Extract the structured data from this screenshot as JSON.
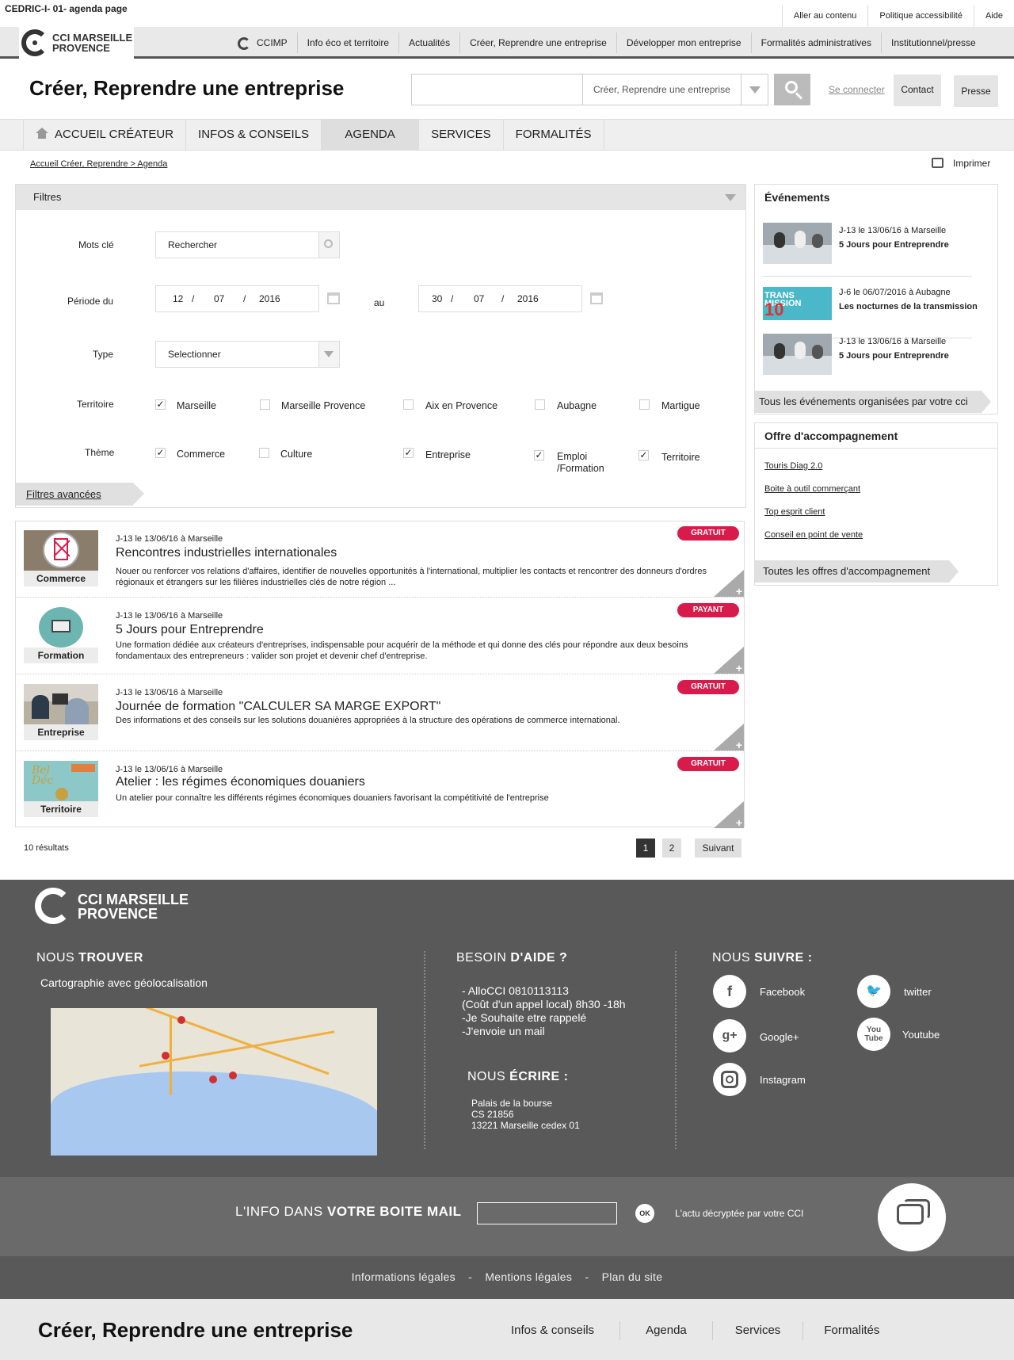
{
  "doc_title": "CEDRIC-I- 01- agenda page",
  "top_links": [
    "Aller au contenu",
    "Politique accessibilité",
    "Aide"
  ],
  "logo": {
    "line1": "CCI MARSEILLE",
    "line2": "PROVENCE"
  },
  "main_nav": [
    "CCIMP",
    "Info éco et territoire",
    "Actualités",
    "Créer, Reprendre une entreprise",
    "Développer mon entreprise",
    "Formalités administratives",
    "Institutionnel/presse"
  ],
  "section_title": "Créer, Reprendre une entreprise",
  "search": {
    "scope": "Créer, Reprendre une entreprise",
    "login": "Se connecter",
    "contact": "Contact",
    "presse": "Presse"
  },
  "sub_nav": [
    "ACCUEIL CRÉATEUR",
    "INFOS & CONSEILS",
    "AGENDA",
    "SERVICES",
    "FORMALITÉS"
  ],
  "breadcrumb": "Accueil Créer, Reprendre > Agenda",
  "print": "Imprimer",
  "filters": {
    "title": "Filtres",
    "keywords_label": "Mots clé",
    "keywords_placeholder": "Rechercher",
    "period_label": "Période du",
    "to_label": "au",
    "from_date": {
      "d": "12",
      "m": "07",
      "y": "2016"
    },
    "to_date": {
      "d": "30",
      "m": "07",
      "y": "2016"
    },
    "sep": "/",
    "type_label": "Type",
    "type_value": "Selectionner",
    "territory_label": "Territoire",
    "territories": [
      {
        "label": "Marseille",
        "checked": true
      },
      {
        "label": "Marseille Provence",
        "checked": false
      },
      {
        "label": "Aix en Provence",
        "checked": false
      },
      {
        "label": "Aubagne",
        "checked": false
      },
      {
        "label": "Martigue",
        "checked": false
      }
    ],
    "theme_label": "Thème",
    "themes": [
      {
        "label": "Commerce",
        "checked": true
      },
      {
        "label": "Culture",
        "checked": false
      },
      {
        "label": "Entreprise",
        "checked": true
      },
      {
        "label": "Emploi /Formation",
        "checked": true
      },
      {
        "label": "Territoire",
        "checked": true
      }
    ],
    "advanced": "Filtres avancées"
  },
  "events": [
    {
      "category": "Commerce",
      "date": "J-13  le 13/06/16  à Marseille",
      "title": "Rencontres industrielles internationales",
      "desc": "Nouer ou renforcer vos relations d'affaires, identifier de nouvelles opportunités à l'international, multiplier les contacts et rencontrer des donneurs d'ordres régionaux et étrangers sur les filières industrielles clés de notre région ...",
      "badge": "GRATUIT"
    },
    {
      "category": "Formation",
      "date": "J-13  le 13/06/16  à Marseille",
      "title": "5 Jours pour Entreprendre",
      "desc": "Une formation dédiée aux créateurs d'entreprises, indispensable pour acquérir de la méthode et qui donne des clés pour répondre aux deux besoins fondamentaux des entrepreneurs : valider son projet et devenir chef d'entreprise.",
      "badge": "PAYANT"
    },
    {
      "category": "Entreprise",
      "date": "J-13  le 13/06/16  à Marseille",
      "title": "Journée de formation \"CALCULER SA MARGE EXPORT\"",
      "desc": " Des informations et des conseils sur les solutions douanières appropriées à la structure des opérations de commerce international.",
      "badge": "GRATUIT"
    },
    {
      "category": "Territoire",
      "date": "J-13  le 13/06/16  à Marseille",
      "title": "Atelier : les régimes économiques douaniers",
      "desc": "Un atelier pour connaître les différents régimes économiques douaniers favorisant la compétitivité de l'entreprise",
      "badge": "GRATUIT"
    }
  ],
  "results": "10 résultats",
  "pagination": {
    "pages": [
      "1",
      "2"
    ],
    "next": "Suivant"
  },
  "sidebar": {
    "events_title": "Événements",
    "events": [
      {
        "meta": "J-13  le 13/06/16  à Marseille",
        "title": "5 Jours pour Entreprendre"
      },
      {
        "meta": "J-6  le 06/07/2016 à  Aubagne",
        "title": "Les nocturnes de la transmission"
      },
      {
        "meta": "J-13  le 13/06/16  à Marseille",
        "title": "5 Jours pour Entreprendre"
      }
    ],
    "events_cta": "Tous les événements organisées par votre cci",
    "offer_title": "Offre d'accompagnement",
    "offer_links": [
      "Touris Diag 2.0",
      "Boite à outil commerçant",
      "Top esprit client",
      "Conseil en point de vente"
    ],
    "offer_cta": "Toutes les offres d'accompagnement"
  },
  "footer": {
    "logo": {
      "line1": "CCI MARSEILLE",
      "line2": "PROVENCE"
    },
    "find": {
      "h1": "NOUS ",
      "h2": "TROUVER",
      "text": "Cartographie avec géolocalisation"
    },
    "help": {
      "h1": "BESOIN ",
      "h2": "D'AIDE ?",
      "lines": [
        "- AlloCCI 0810113113",
        "(Coût d'un appel local) 8h30 -18h",
        "-Je Souhaite etre rappelé",
        "-J'envoie un mail"
      ]
    },
    "write": {
      "h1": "NOUS ",
      "h2": "ÉCRIRE :",
      "lines": [
        "Palais de la bourse",
        "CS 21856",
        "13221 Marseille cedex 01"
      ]
    },
    "follow": {
      "h1": "NOUS ",
      "h2": "SUIVRE :"
    },
    "social": [
      "Facebook",
      "twitter",
      "Google+",
      "Youtube",
      "Instagram"
    ],
    "newsletter": {
      "h1": "L'INFO DANS ",
      "h2": "VOTRE BOITE MAIL",
      "ok": "OK",
      "tagline": "L'actu décryptée par votre CCI"
    },
    "legal": [
      "Informations légales",
      "-",
      "Mentions légales",
      "-",
      "Plan du site"
    ],
    "bottom_title": "Créer, Reprendre une entreprise",
    "bottom_links": [
      "Infos & conseils",
      "Agenda",
      "Services",
      "Formalités"
    ]
  },
  "colors": {
    "badge": "#d81b4a",
    "footer": "#595959"
  }
}
